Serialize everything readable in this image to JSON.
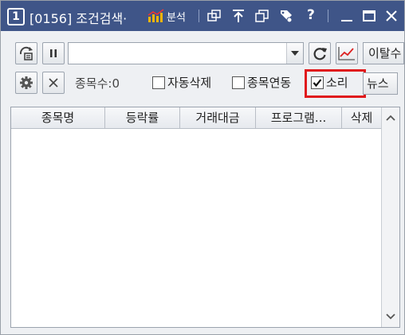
{
  "titlebar": {
    "window_number": "1",
    "title": "[0156] 조건검색·",
    "analyze_label": "분석",
    "help_label": "?"
  },
  "toolbar": {
    "combo_value": "",
    "deviation_button": "이탈수"
  },
  "options": {
    "count_label": "종목수:0",
    "auto_delete_label": "자동삭제",
    "auto_delete_checked": false,
    "link_label": "종목연동",
    "link_checked": false,
    "sound_label": "소리",
    "sound_checked": true,
    "news_label": "뉴스"
  },
  "table": {
    "columns": [
      "종목명",
      "등락률",
      "거래대금",
      "프로그램...",
      "삭제"
    ],
    "rows": []
  },
  "colors": {
    "titlebar_bg": "#3f5588",
    "highlight_border": "#e0191c"
  }
}
